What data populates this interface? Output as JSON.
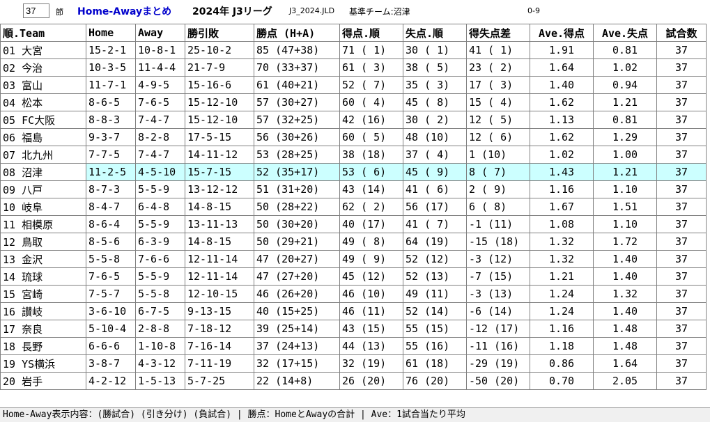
{
  "header": {
    "round_value": "37",
    "round_suffix": "節",
    "title": "Home-Awayまとめ",
    "season": "2024年 J3リーグ",
    "file": "J3_2024.JLD",
    "base_team": "基準チーム:沼津",
    "range": "0-9"
  },
  "table": {
    "columns": [
      "順.Team",
      "Home",
      "Away",
      "勝引敗",
      "勝点 (H+A)",
      "得点.順",
      "失点.順",
      "得失点差",
      "Ave.得点",
      "Ave.失点",
      "試合数"
    ],
    "highlight_index": 7,
    "rows": [
      [
        "01 大宮",
        "15-2-1",
        "10-8-1",
        "25-10-2",
        "85 (47+38)",
        "71 ( 1)",
        "30 ( 1)",
        "41 ( 1)",
        "1.91",
        "0.81",
        "37"
      ],
      [
        "02 今治",
        "10-3-5",
        "11-4-4",
        "21-7-9",
        "70 (33+37)",
        "61 ( 3)",
        "38 ( 5)",
        "23 ( 2)",
        "1.64",
        "1.02",
        "37"
      ],
      [
        "03 富山",
        "11-7-1",
        "4-9-5",
        "15-16-6",
        "61 (40+21)",
        "52 ( 7)",
        "35 ( 3)",
        "17 ( 3)",
        "1.40",
        "0.94",
        "37"
      ],
      [
        "04 松本",
        "8-6-5",
        "7-6-5",
        "15-12-10",
        "57 (30+27)",
        "60 ( 4)",
        "45 ( 8)",
        "15 ( 4)",
        "1.62",
        "1.21",
        "37"
      ],
      [
        "05 FC大阪",
        "8-8-3",
        "7-4-7",
        "15-12-10",
        "57 (32+25)",
        "42 (16)",
        "30 ( 2)",
        "12 ( 5)",
        "1.13",
        "0.81",
        "37"
      ],
      [
        "06 福島",
        "9-3-7",
        "8-2-8",
        "17-5-15",
        "56 (30+26)",
        "60 ( 5)",
        "48 (10)",
        "12 ( 6)",
        "1.62",
        "1.29",
        "37"
      ],
      [
        "07 北九州",
        "7-7-5",
        "7-4-7",
        "14-11-12",
        "53 (28+25)",
        "38 (18)",
        "37 ( 4)",
        "1 (10)",
        "1.02",
        "1.00",
        "37"
      ],
      [
        "08 沼津",
        "11-2-5",
        "4-5-10",
        "15-7-15",
        "52 (35+17)",
        "53 ( 6)",
        "45 ( 9)",
        "8 ( 7)",
        "1.43",
        "1.21",
        "37"
      ],
      [
        "09 八戸",
        "8-7-3",
        "5-5-9",
        "13-12-12",
        "51 (31+20)",
        "43 (14)",
        "41 ( 6)",
        "2 ( 9)",
        "1.16",
        "1.10",
        "37"
      ],
      [
        "10 岐阜",
        "8-4-7",
        "6-4-8",
        "14-8-15",
        "50 (28+22)",
        "62 ( 2)",
        "56 (17)",
        "6 ( 8)",
        "1.67",
        "1.51",
        "37"
      ],
      [
        "11 相模原",
        "8-6-4",
        "5-5-9",
        "13-11-13",
        "50 (30+20)",
        "40 (17)",
        "41 ( 7)",
        "-1 (11)",
        "1.08",
        "1.10",
        "37"
      ],
      [
        "12 鳥取",
        "8-5-6",
        "6-3-9",
        "14-8-15",
        "50 (29+21)",
        "49 ( 8)",
        "64 (19)",
        "-15 (18)",
        "1.32",
        "1.72",
        "37"
      ],
      [
        "13 金沢",
        "5-5-8",
        "7-6-6",
        "12-11-14",
        "47 (20+27)",
        "49 ( 9)",
        "52 (12)",
        "-3 (12)",
        "1.32",
        "1.40",
        "37"
      ],
      [
        "14 琉球",
        "7-6-5",
        "5-5-9",
        "12-11-14",
        "47 (27+20)",
        "45 (12)",
        "52 (13)",
        "-7 (15)",
        "1.21",
        "1.40",
        "37"
      ],
      [
        "15 宮崎",
        "7-5-7",
        "5-5-8",
        "12-10-15",
        "46 (26+20)",
        "46 (10)",
        "49 (11)",
        "-3 (13)",
        "1.24",
        "1.32",
        "37"
      ],
      [
        "16 讃岐",
        "3-6-10",
        "6-7-5",
        "9-13-15",
        "40 (15+25)",
        "46 (11)",
        "52 (14)",
        "-6 (14)",
        "1.24",
        "1.40",
        "37"
      ],
      [
        "17 奈良",
        "5-10-4",
        "2-8-8",
        "7-18-12",
        "39 (25+14)",
        "43 (15)",
        "55 (15)",
        "-12 (17)",
        "1.16",
        "1.48",
        "37"
      ],
      [
        "18 長野",
        "6-6-6",
        "1-10-8",
        "7-16-14",
        "37 (24+13)",
        "44 (13)",
        "55 (16)",
        "-11 (16)",
        "1.18",
        "1.48",
        "37"
      ],
      [
        "19 YS横浜",
        "3-8-7",
        "4-3-12",
        "7-11-19",
        "32 (17+15)",
        "32 (19)",
        "61 (18)",
        "-29 (19)",
        "0.86",
        "1.64",
        "37"
      ],
      [
        "20 岩手",
        "4-2-12",
        "1-5-13",
        "5-7-25",
        "22 (14+8)",
        "26 (20)",
        "76 (20)",
        "-50 (20)",
        "0.70",
        "2.05",
        "37"
      ]
    ]
  },
  "footer": {
    "text": "Home-Away表示内容：(勝試合) (引き分け) (負試合) | 勝点：HomeとAwayの合計  | Ave：1試合当たり平均"
  }
}
